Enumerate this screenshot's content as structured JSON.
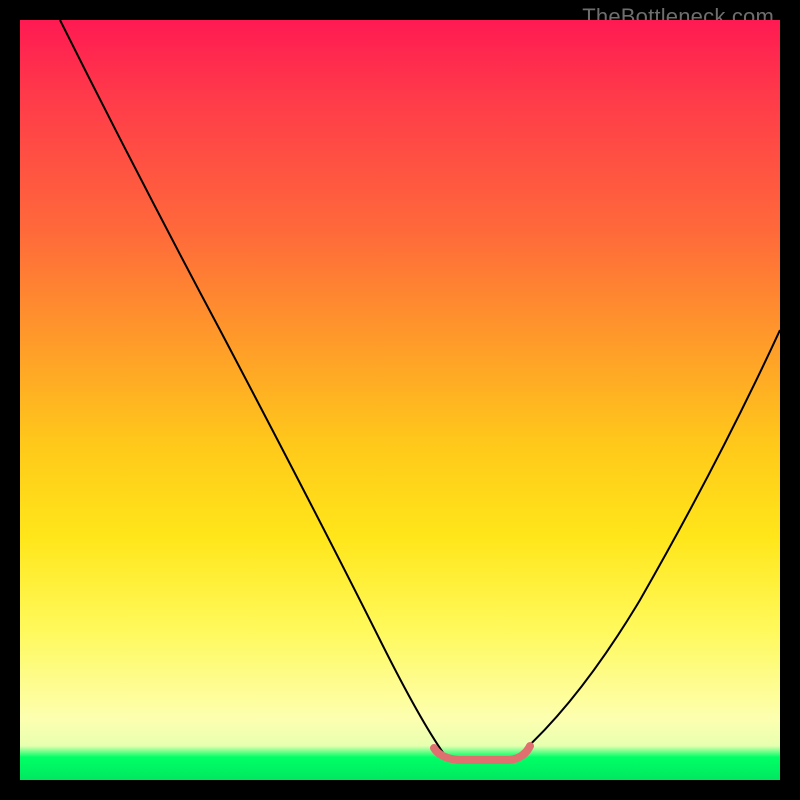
{
  "watermark": "TheBottleneck.com",
  "chart_data": {
    "type": "line",
    "title": "",
    "xlabel": "",
    "ylabel": "",
    "xrange": [
      0,
      760
    ],
    "yrange": [
      0,
      760
    ],
    "left_curve": {
      "description": "descending arc from top-left to valley floor",
      "points": [
        [
          40,
          0
        ],
        [
          120,
          150
        ],
        [
          200,
          310
        ],
        [
          280,
          470
        ],
        [
          350,
          610
        ],
        [
          400,
          700
        ],
        [
          424,
          734
        ]
      ]
    },
    "right_curve": {
      "description": "ascending arc from valley floor to upper-right",
      "points": [
        [
          500,
          734
        ],
        [
          540,
          700
        ],
        [
          600,
          620
        ],
        [
          660,
          520
        ],
        [
          720,
          400
        ],
        [
          760,
          310
        ]
      ]
    },
    "valley_accent": {
      "description": "flat salmon segment along valley bottom",
      "points": [
        [
          414,
          730
        ],
        [
          420,
          736
        ],
        [
          436,
          740
        ],
        [
          462,
          740
        ],
        [
          490,
          740
        ],
        [
          504,
          734
        ],
        [
          510,
          726
        ]
      ],
      "color": "#e07070"
    },
    "gradient_stops": [
      {
        "pos": 0.0,
        "color": "#ff1a52"
      },
      {
        "pos": 0.28,
        "color": "#ff6a3a"
      },
      {
        "pos": 0.56,
        "color": "#ffc91a"
      },
      {
        "pos": 0.8,
        "color": "#fff95a"
      },
      {
        "pos": 0.96,
        "color": "#e8ffb0"
      },
      {
        "pos": 1.0,
        "color": "#00e860"
      }
    ]
  }
}
